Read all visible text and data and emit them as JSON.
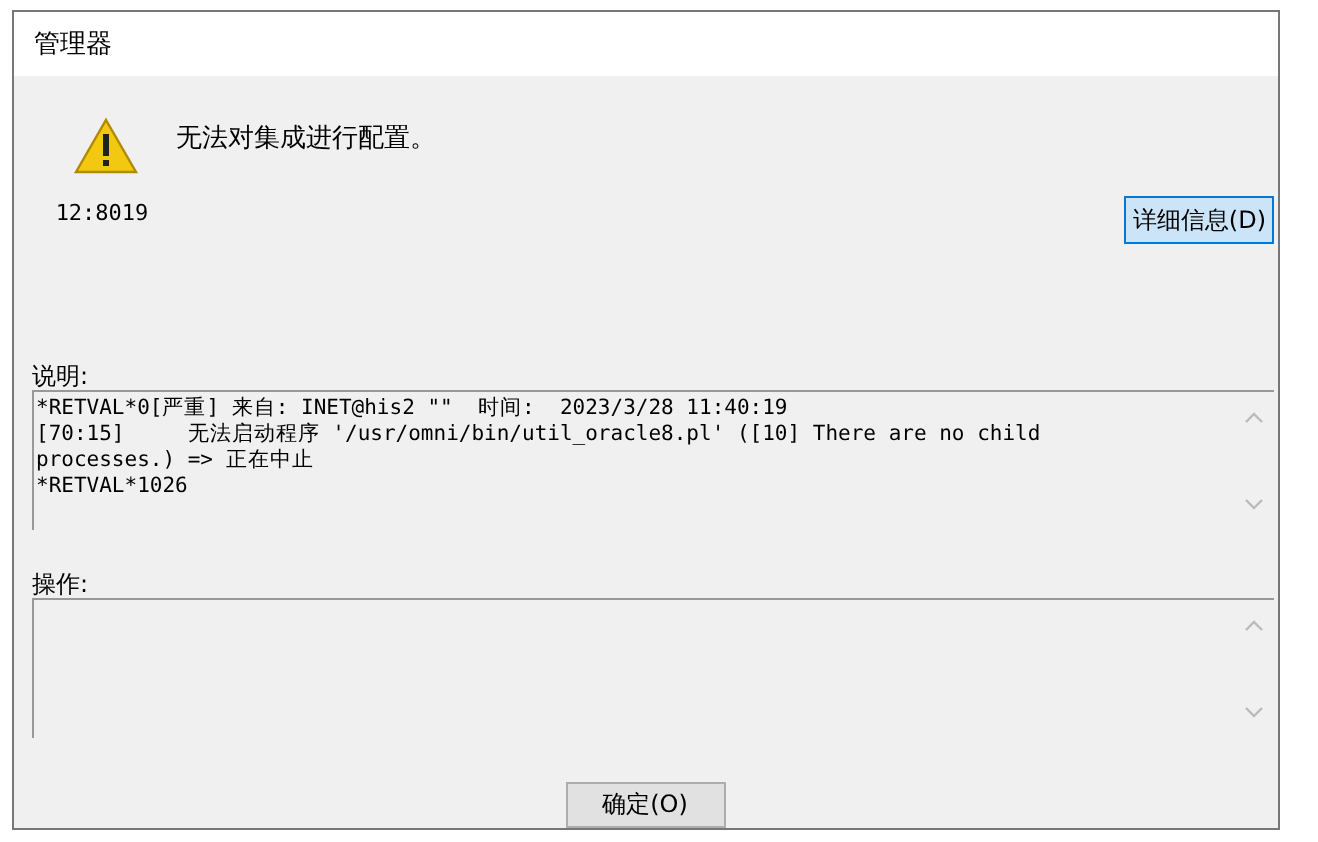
{
  "window": {
    "title": "管理器"
  },
  "message": "无法对集成进行配置。",
  "code": "12:8019",
  "details_button": "详细信息(D)",
  "description": {
    "label": "说明:",
    "lines": [
      "*RETVAL*0[严重] 来自: INET@his2 \"\"  时间:  2023/3/28 11:40:19",
      "[70:15]     无法启动程序 '/usr/omni/bin/util_oracle8.pl' ([10] There are no child",
      "processes.) => 正在中止",
      "*RETVAL*1026"
    ]
  },
  "action": {
    "label": "操作:"
  },
  "buttons": [
    "确定(O)"
  ]
}
